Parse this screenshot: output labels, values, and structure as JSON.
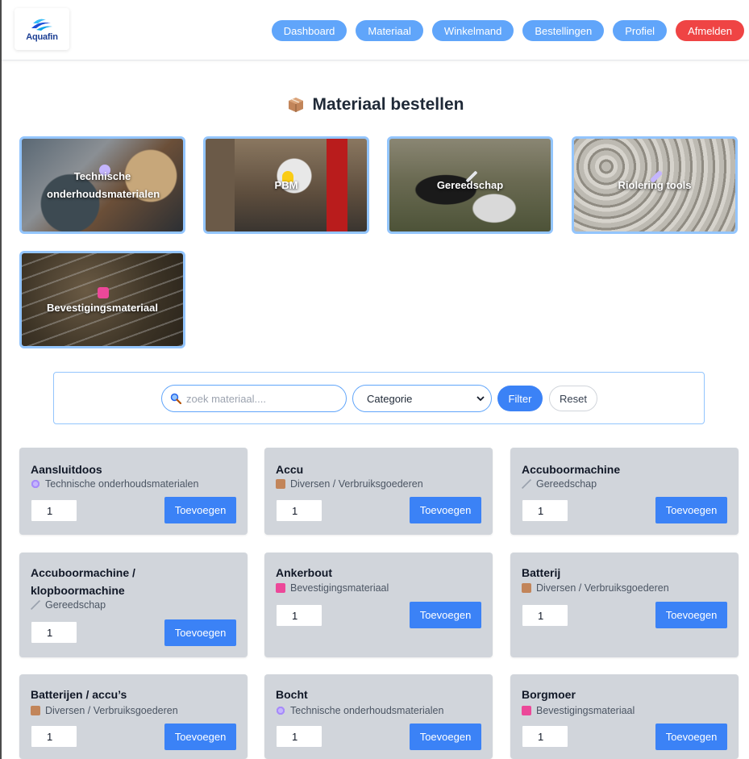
{
  "brand": {
    "name": "Aquafin"
  },
  "nav": {
    "items": [
      "Dashboard",
      "Materiaal",
      "Winkelmand",
      "Bestellingen",
      "Profiel"
    ],
    "logout": "Afmelden"
  },
  "page": {
    "title": "Materiaal bestellen",
    "title_icon": "package-icon"
  },
  "categories": [
    {
      "label": "Technische onderhoudsmaterialen"
    },
    {
      "label": "PBM"
    },
    {
      "label": "Gereedschap"
    },
    {
      "label": "Riolering tools"
    },
    {
      "label": "Bevestigingsmateriaal"
    }
  ],
  "filter": {
    "search_placeholder": "zoek materiaal....",
    "category_selected": "Categorie",
    "filter_label": "Filter",
    "reset_label": "Reset"
  },
  "products": [
    {
      "name": "Aansluitdoos",
      "category": "Technische onderhoudsmaterialen",
      "icon": "gear-icon",
      "qty": "1",
      "button": "Toevoegen"
    },
    {
      "name": "Accu",
      "category": "Diversen / Verbruiksgoederen",
      "icon": "package-icon",
      "qty": "1",
      "button": "Toevoegen"
    },
    {
      "name": "Accuboormachine",
      "category": "Gereedschap",
      "icon": "tool-icon",
      "qty": "1",
      "button": "Toevoegen"
    },
    {
      "name": "Accuboormachine / klopboormachine",
      "category": "Gereedschap",
      "icon": "tool-icon",
      "qty": "1",
      "button": "Toevoegen"
    },
    {
      "name": "Ankerbout",
      "category": "Bevestigingsmateriaal",
      "icon": "toolbox-icon",
      "qty": "1",
      "button": "Toevoegen"
    },
    {
      "name": "Batterij",
      "category": "Diversen / Verbruiksgoederen",
      "icon": "package-icon",
      "qty": "1",
      "button": "Toevoegen"
    },
    {
      "name": "Batterijen / accu’s",
      "category": "Diversen / Verbruiksgoederen",
      "icon": "package-icon",
      "qty": "1",
      "button": "Toevoegen"
    },
    {
      "name": "Bocht",
      "category": "Technische onderhoudsmaterialen",
      "icon": "gear-icon",
      "qty": "1",
      "button": "Toevoegen"
    },
    {
      "name": "Borgmoer",
      "category": "Bevestigingsmateriaal",
      "icon": "toolbox-icon",
      "qty": "1",
      "button": "Toevoegen"
    }
  ],
  "colors": {
    "nav": "#60a5fa",
    "logout": "#ef4444",
    "primary": "#3b82f6",
    "tile_border": "#93c5fd",
    "card_bg": "#d1d5db"
  }
}
